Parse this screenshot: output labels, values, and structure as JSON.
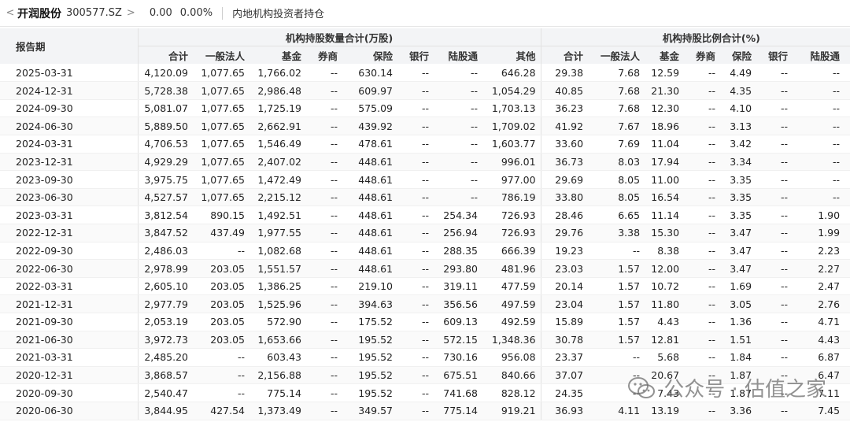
{
  "header": {
    "back_chevron": "<",
    "stock_name": "开润股份",
    "stock_code": "300577.SZ",
    "forward_chevron": ">",
    "price_change": "0.00",
    "pct_change": "0.00%",
    "page_title": "内地机构投资者持仓"
  },
  "table": {
    "period_header": "报告期",
    "group_shares": "机构持股数量合计(万股)",
    "group_ratio": "机构持股比例合计(%)",
    "columns_shares": [
      "合计",
      "一般法人",
      "基金",
      "券商",
      "保险",
      "银行",
      "陆股通",
      "其他"
    ],
    "columns_ratio": [
      "合计",
      "一般法人",
      "基金",
      "券商",
      "保险",
      "银行",
      "陆股通",
      "其他"
    ],
    "rows": [
      [
        "2025-03-31",
        "4,120.09",
        "1,077.65",
        "1,766.02",
        "--",
        "630.14",
        "--",
        "--",
        "646.28",
        "29.38",
        "7.68",
        "12.59",
        "--",
        "4.49",
        "--",
        "--",
        "4.61"
      ],
      [
        "2024-12-31",
        "5,728.38",
        "1,077.65",
        "2,986.48",
        "--",
        "609.97",
        "--",
        "--",
        "1,054.29",
        "40.85",
        "7.68",
        "21.30",
        "--",
        "4.35",
        "--",
        "--",
        "7.52"
      ],
      [
        "2024-09-30",
        "5,081.07",
        "1,077.65",
        "1,725.19",
        "--",
        "575.09",
        "--",
        "--",
        "1,703.13",
        "36.23",
        "7.68",
        "12.30",
        "--",
        "4.10",
        "--",
        "--",
        "12.14"
      ],
      [
        "2024-06-30",
        "5,889.50",
        "1,077.65",
        "2,662.91",
        "--",
        "439.92",
        "--",
        "--",
        "1,709.02",
        "41.92",
        "7.67",
        "18.96",
        "--",
        "3.13",
        "--",
        "--",
        "12.17"
      ],
      [
        "2024-03-31",
        "4,706.53",
        "1,077.65",
        "1,546.49",
        "--",
        "478.61",
        "--",
        "--",
        "1,603.77",
        "33.60",
        "7.69",
        "11.04",
        "--",
        "3.42",
        "--",
        "--",
        "11.45"
      ],
      [
        "2023-12-31",
        "4,929.29",
        "1,077.65",
        "2,407.02",
        "--",
        "448.61",
        "--",
        "--",
        "996.01",
        "36.73",
        "8.03",
        "17.94",
        "--",
        "3.34",
        "--",
        "--",
        "7.42"
      ],
      [
        "2023-09-30",
        "3,975.75",
        "1,077.65",
        "1,472.49",
        "--",
        "448.61",
        "--",
        "--",
        "977.00",
        "29.69",
        "8.05",
        "11.00",
        "--",
        "3.35",
        "--",
        "--",
        "7.30"
      ],
      [
        "2023-06-30",
        "4,527.57",
        "1,077.65",
        "2,215.12",
        "--",
        "448.61",
        "--",
        "--",
        "786.19",
        "33.80",
        "8.05",
        "16.54",
        "--",
        "3.35",
        "--",
        "--",
        "5.87"
      ],
      [
        "2023-03-31",
        "3,812.54",
        "890.15",
        "1,492.51",
        "--",
        "448.61",
        "--",
        "254.34",
        "726.93",
        "28.46",
        "6.65",
        "11.14",
        "--",
        "3.35",
        "--",
        "1.90",
        "5.43"
      ],
      [
        "2022-12-31",
        "3,847.52",
        "437.49",
        "1,977.55",
        "--",
        "448.61",
        "--",
        "256.94",
        "726.93",
        "29.76",
        "3.38",
        "15.30",
        "--",
        "3.47",
        "--",
        "1.99",
        "5.62"
      ],
      [
        "2022-09-30",
        "2,486.03",
        "--",
        "1,082.68",
        "--",
        "448.61",
        "--",
        "288.35",
        "666.39",
        "19.23",
        "--",
        "8.38",
        "--",
        "3.47",
        "--",
        "2.23",
        "5.15"
      ],
      [
        "2022-06-30",
        "2,978.99",
        "203.05",
        "1,551.57",
        "--",
        "448.61",
        "--",
        "293.80",
        "481.96",
        "23.03",
        "1.57",
        "12.00",
        "--",
        "3.47",
        "--",
        "2.27",
        "3.73"
      ],
      [
        "2022-03-31",
        "2,605.10",
        "203.05",
        "1,386.25",
        "--",
        "219.10",
        "--",
        "319.11",
        "477.59",
        "20.14",
        "1.57",
        "10.72",
        "--",
        "1.69",
        "--",
        "2.47",
        "3.69"
      ],
      [
        "2021-12-31",
        "2,977.79",
        "203.05",
        "1,525.96",
        "--",
        "394.63",
        "--",
        "356.56",
        "497.59",
        "23.04",
        "1.57",
        "11.80",
        "--",
        "3.05",
        "--",
        "2.76",
        "3.85"
      ],
      [
        "2021-09-30",
        "2,053.19",
        "203.05",
        "572.90",
        "--",
        "175.52",
        "--",
        "609.13",
        "492.59",
        "15.89",
        "1.57",
        "4.43",
        "--",
        "1.36",
        "--",
        "4.71",
        "3.81"
      ],
      [
        "2021-06-30",
        "3,972.73",
        "203.05",
        "1,653.66",
        "--",
        "195.52",
        "--",
        "572.15",
        "1,348.36",
        "30.78",
        "1.57",
        "12.81",
        "--",
        "1.51",
        "--",
        "4.43",
        "10.45"
      ],
      [
        "2021-03-31",
        "2,485.20",
        "--",
        "603.43",
        "--",
        "195.52",
        "--",
        "730.16",
        "956.08",
        "23.37",
        "--",
        "5.68",
        "--",
        "1.84",
        "--",
        "6.87",
        "8.99"
      ],
      [
        "2020-12-31",
        "3,868.57",
        "--",
        "2,156.88",
        "--",
        "195.52",
        "--",
        "675.51",
        "840.66",
        "37.07",
        "--",
        "20.67",
        "--",
        "1.87",
        "--",
        "6.47",
        "8.06"
      ],
      [
        "2020-09-30",
        "2,540.47",
        "--",
        "775.14",
        "--",
        "195.52",
        "--",
        "741.68",
        "828.12",
        "24.35",
        "--",
        "7.43",
        "--",
        "1.87",
        "--",
        "7.11",
        "7.94"
      ],
      [
        "2020-06-30",
        "3,844.95",
        "427.54",
        "1,373.49",
        "--",
        "349.57",
        "--",
        "775.14",
        "919.21",
        "36.93",
        "4.11",
        "13.19",
        "--",
        "3.36",
        "--",
        "7.45",
        "8.83"
      ]
    ]
  },
  "watermark": {
    "text": "公众号 · 估值之家",
    "icon": "wechat-icon"
  }
}
